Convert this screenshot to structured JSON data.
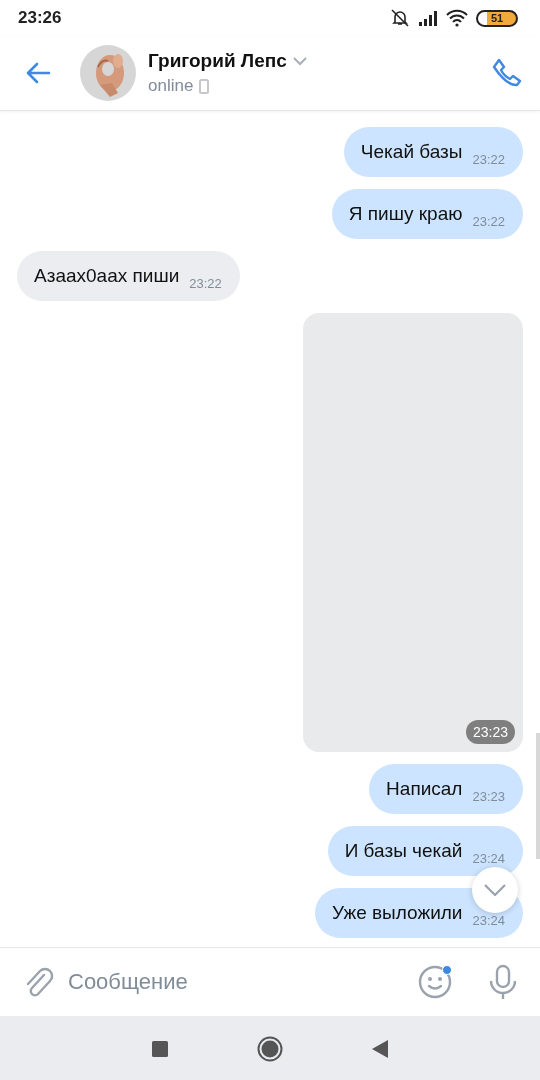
{
  "status_bar": {
    "time": "23:26",
    "battery": "51"
  },
  "header": {
    "name": "Григорий Лепс",
    "status": "online"
  },
  "messages": [
    {
      "kind": "text",
      "outgoing": true,
      "text": "Чекай базы",
      "time": "23:22"
    },
    {
      "kind": "text",
      "outgoing": true,
      "text": "Я пишу краю",
      "time": "23:22"
    },
    {
      "kind": "text",
      "outgoing": false,
      "text": "Азаах0аах пиши",
      "time": "23:22"
    },
    {
      "outgoing": true,
      "time": "23:23"
    },
    {
      "kind": "text",
      "outgoing": true,
      "text": "Написал",
      "time": "23:23"
    },
    {
      "kind": "text",
      "outgoing": true,
      "text": "И базы чекай",
      "time": "23:24"
    },
    {
      "kind": "text",
      "outgoing": true,
      "text": "Уже выложили",
      "time": "23:24"
    }
  ],
  "composer": {
    "placeholder": "Сообщение",
    "emoji_badge": true
  }
}
